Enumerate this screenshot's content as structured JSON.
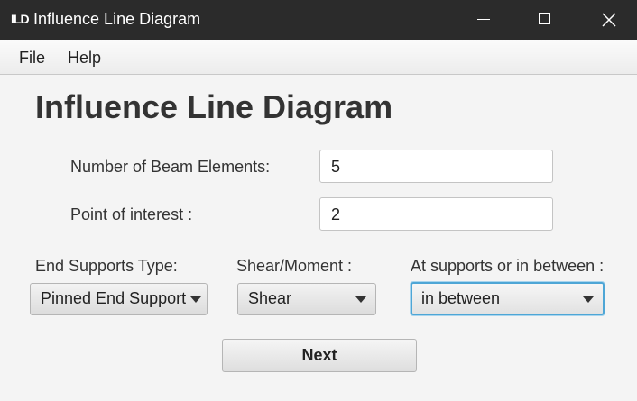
{
  "window": {
    "icon_text": "ILD",
    "title": "Influence Line Diagram"
  },
  "menu": {
    "items": [
      "File",
      "Help"
    ]
  },
  "main": {
    "heading": "Influence Line Diagram",
    "beam_elements_label": "Number of Beam Elements:",
    "beam_elements_value": "5",
    "point_of_interest_label": "Point of interest :",
    "point_of_interest_value": "2",
    "end_supports_label": "End Supports Type:",
    "end_supports_value": "Pinned End Support",
    "shear_moment_label": "Shear/Moment :",
    "shear_moment_value": "Shear",
    "location_label": "At supports or in between :",
    "location_value": "in between",
    "next_label": "Next"
  },
  "colors": {
    "titlebar": "#2b2b2b",
    "focus_ring": "#4ea6d6"
  }
}
